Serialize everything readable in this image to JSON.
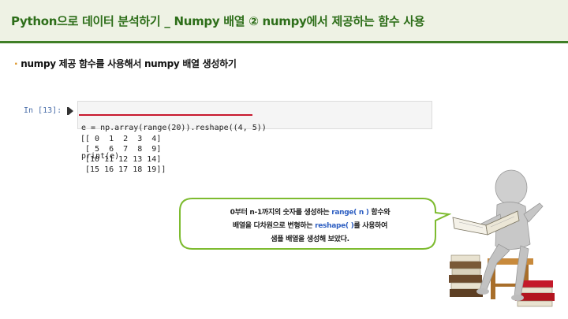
{
  "header": {
    "title": "Python으로 데이터 분석하기 _ Numpy 배열 ② numpy에서 제공하는 함수 사용"
  },
  "section": {
    "bullet": "·",
    "heading": "numpy 제공 함수를 사용해서 numpy 배열 생성하기"
  },
  "notebook": {
    "prompt": "In [13]:",
    "code_lines": [
      "e = np.array(range(20)).reshape((4, 5))",
      "print(e)"
    ],
    "output_lines": [
      "[[ 0  1  2  3  4]",
      " [ 5  6  7  8  9]",
      " [10 11 12 13 14]",
      " [15 16 17 18 19]]"
    ]
  },
  "callout": {
    "line1_a": "0부터 n-1까지의 숫자를 생성하는 ",
    "line1_kw": "range( n )",
    "line1_b": " 함수와",
    "line2_a": "배열을 다차원으로 변형하는 ",
    "line2_kw": "reshape( )",
    "line2_b": "를 사용하여",
    "line3": "샘플 배열을 생성해 보았다."
  },
  "colors": {
    "title_green": "#2d6e19",
    "rule_green": "#3f7f26",
    "bubble_border": "#7dbb2f",
    "keyword_blue": "#2e5fc2",
    "highlight_red": "#c8192e"
  }
}
